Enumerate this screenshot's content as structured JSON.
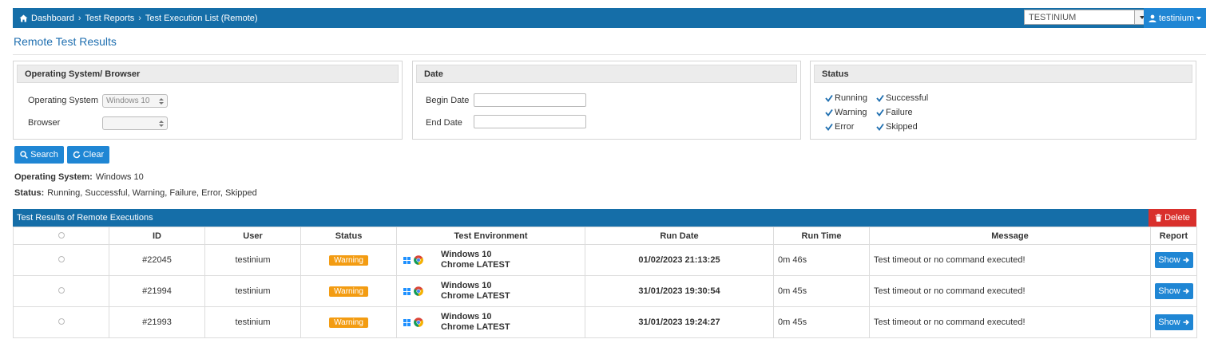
{
  "breadcrumb": {
    "items": [
      "Dashboard",
      "Test Reports",
      "Test Execution List (Remote)"
    ]
  },
  "header": {
    "project_select": "TESTINIUM",
    "user": "testinium",
    "colors": {
      "bar": "#156ea8",
      "user": "#1f86d4"
    }
  },
  "page_title": "Remote Test Results",
  "filters": {
    "os_browser": {
      "title": "Operating System/ Browser",
      "os_label": "Operating System",
      "os_value": "Windows 10",
      "browser_label": "Browser",
      "browser_value": ""
    },
    "date": {
      "title": "Date",
      "begin_label": "Begin Date",
      "begin_value": "",
      "end_label": "End Date",
      "end_value": ""
    },
    "status": {
      "title": "Status",
      "options": [
        "Running",
        "Successful",
        "Warning",
        "Failure",
        "Error",
        "Skipped"
      ]
    }
  },
  "buttons": {
    "search": "Search",
    "clear": "Clear"
  },
  "summary": {
    "os_label": "Operating System:",
    "os_value": "Windows 10",
    "status_label": "Status:",
    "status_value": "Running, Successful, Warning, Failure, Error, Skipped"
  },
  "results": {
    "title": "Test Results of Remote Executions",
    "delete_label": "Delete",
    "columns": [
      "",
      "ID",
      "User",
      "Status",
      "Test Environment",
      "Run Date",
      "Run Time",
      "Message",
      "Report"
    ],
    "rows": [
      {
        "id": "#22045",
        "user": "testinium",
        "status": "Warning",
        "env_os": "Windows 10",
        "env_browser": "Chrome LATEST",
        "run_date": "01/02/2023 21:13:25",
        "run_time": "0m 46s",
        "message": "Test timeout or no command executed!",
        "report": "Show"
      },
      {
        "id": "#21994",
        "user": "testinium",
        "status": "Warning",
        "env_os": "Windows 10",
        "env_browser": "Chrome LATEST",
        "run_date": "31/01/2023 19:30:54",
        "run_time": "0m 45s",
        "message": "Test timeout or no command executed!",
        "report": "Show"
      },
      {
        "id": "#21993",
        "user": "testinium",
        "status": "Warning",
        "env_os": "Windows 10",
        "env_browser": "Chrome LATEST",
        "run_date": "31/01/2023 19:24:27",
        "run_time": "0m 45s",
        "message": "Test timeout or no command executed!",
        "report": "Show"
      }
    ]
  }
}
